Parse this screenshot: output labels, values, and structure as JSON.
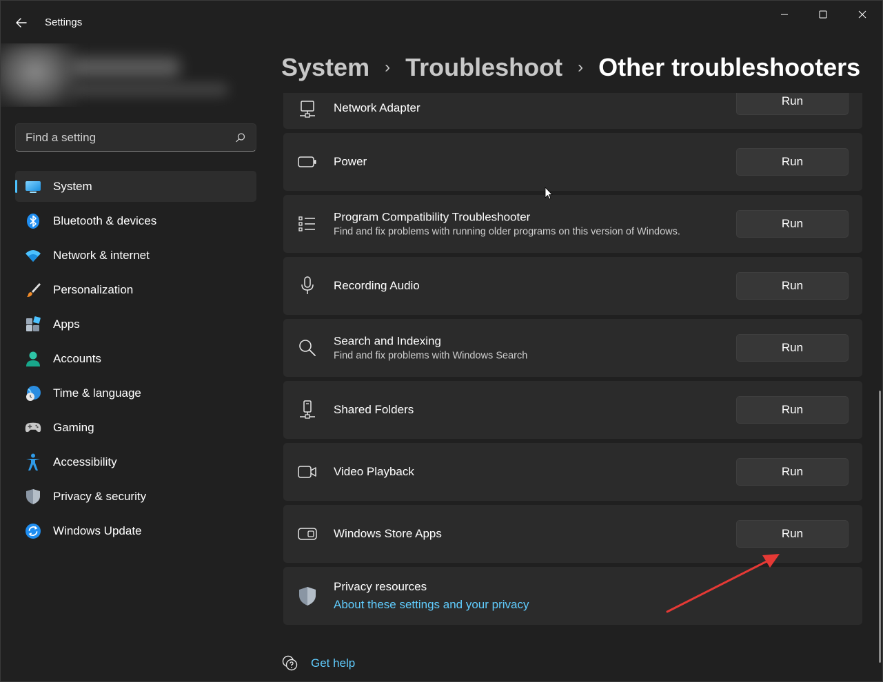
{
  "window": {
    "title": "Settings",
    "controls": [
      "minimize",
      "maximize",
      "close"
    ]
  },
  "search": {
    "placeholder": "Find a setting"
  },
  "sidebar": {
    "items": [
      {
        "label": "System",
        "icon": "monitor-icon",
        "selected": true
      },
      {
        "label": "Bluetooth & devices",
        "icon": "bluetooth-icon"
      },
      {
        "label": "Network & internet",
        "icon": "wifi-icon"
      },
      {
        "label": "Personalization",
        "icon": "paintbrush-icon"
      },
      {
        "label": "Apps",
        "icon": "apps-icon"
      },
      {
        "label": "Accounts",
        "icon": "person-icon"
      },
      {
        "label": "Time & language",
        "icon": "globe-clock-icon"
      },
      {
        "label": "Gaming",
        "icon": "gamepad-icon"
      },
      {
        "label": "Accessibility",
        "icon": "accessibility-icon"
      },
      {
        "label": "Privacy & security",
        "icon": "shield-icon"
      },
      {
        "label": "Windows Update",
        "icon": "update-icon"
      }
    ]
  },
  "breadcrumb": {
    "items": [
      "System",
      "Troubleshoot"
    ],
    "current": "Other troubleshooters"
  },
  "troubleshooters": [
    {
      "title": "Network Adapter",
      "description": "",
      "icon": "network-adapter-icon",
      "button": "Run"
    },
    {
      "title": "Power",
      "description": "",
      "icon": "battery-icon",
      "button": "Run"
    },
    {
      "title": "Program Compatibility Troubleshooter",
      "description": "Find and fix problems with running older programs on this version of Windows.",
      "icon": "list-icon",
      "button": "Run"
    },
    {
      "title": "Recording Audio",
      "description": "",
      "icon": "microphone-icon",
      "button": "Run"
    },
    {
      "title": "Search and Indexing",
      "description": "Find and fix problems with Windows Search",
      "icon": "search-icon",
      "button": "Run"
    },
    {
      "title": "Shared Folders",
      "description": "",
      "icon": "shared-folder-icon",
      "button": "Run"
    },
    {
      "title": "Video Playback",
      "description": "",
      "icon": "video-camera-icon",
      "button": "Run"
    },
    {
      "title": "Windows Store Apps",
      "description": "",
      "icon": "store-apps-icon",
      "button": "Run"
    }
  ],
  "privacy": {
    "title": "Privacy resources",
    "link": "About these settings and your privacy",
    "icon": "shield-icon"
  },
  "help": {
    "label": "Get help",
    "icon": "help-chat-icon"
  },
  "colors": {
    "background": "#202020",
    "card": "#2b2b2b",
    "button": "#373737",
    "accent": "#4cc2ff",
    "link": "#60cdff",
    "annotation_arrow": "#e53935"
  }
}
